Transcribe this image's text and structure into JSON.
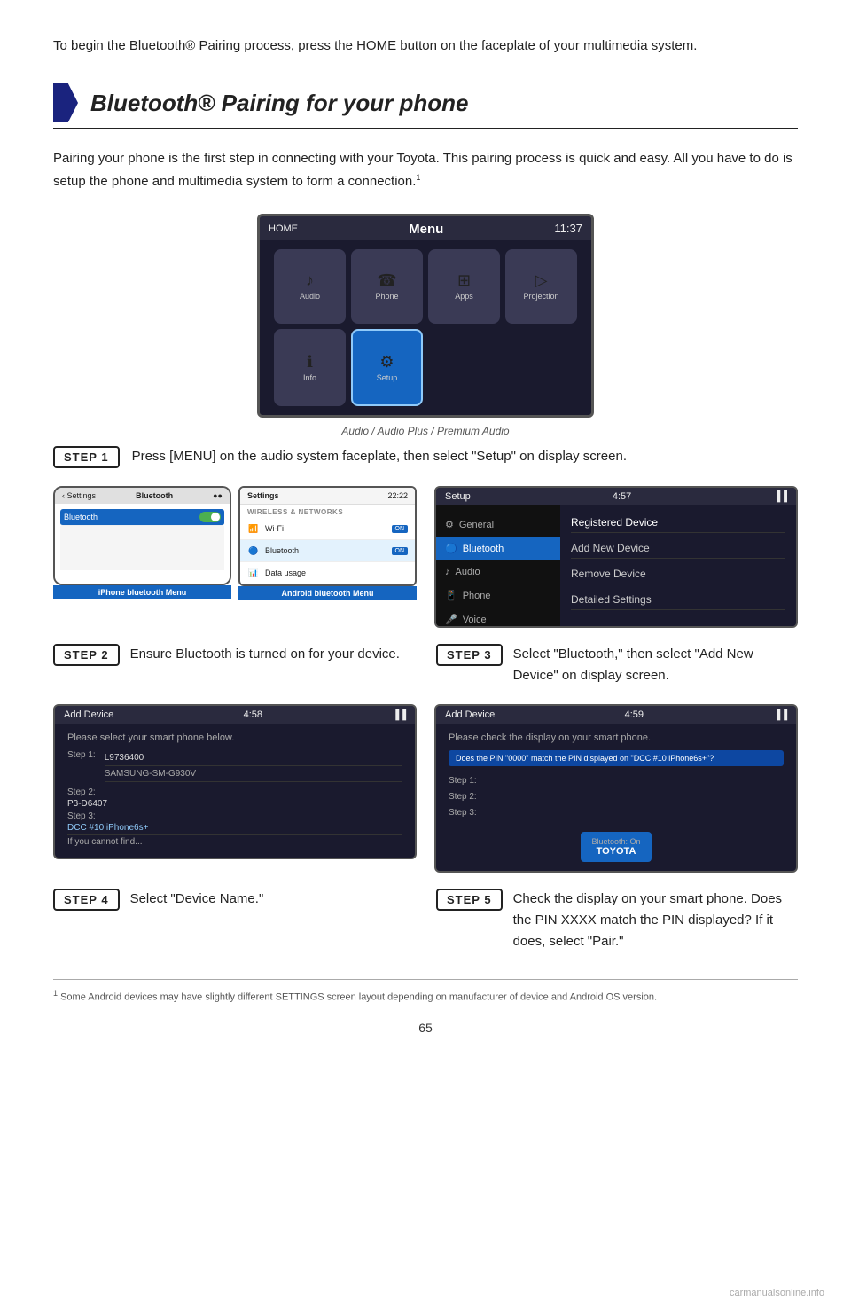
{
  "page": {
    "intro": "To begin the Bluetooth® Pairing process, press the HOME button on the faceplate of your multimedia system.",
    "section_title": "Bluetooth® Pairing for your phone",
    "section_desc": "Pairing your phone is the first step in connecting with your Toyota. This pairing process is quick and easy. All you have to do is setup the phone and multimedia system to form a connection.",
    "footnote_number": "1",
    "screen_caption": "Audio / Audio Plus / Premium Audio",
    "screen": {
      "title": "Menu",
      "time": "11:37",
      "icons": [
        {
          "label": "Audio",
          "sym": "♪"
        },
        {
          "label": "Phone",
          "sym": "📞"
        },
        {
          "label": "Apps",
          "sym": "⊞"
        },
        {
          "label": "Projection",
          "sym": "▶"
        },
        {
          "label": "Info",
          "sym": "ℹ"
        },
        {
          "label": "Setup",
          "sym": "⚙",
          "selected": true
        }
      ]
    },
    "steps": [
      {
        "id": "STEP 1",
        "text": "Press [MENU] on the audio system faceplate, then select \"Setup\" on display screen."
      },
      {
        "id": "STEP 2",
        "text": "Ensure Bluetooth is turned on for your device."
      },
      {
        "id": "STEP 3",
        "text": "Select \"Bluetooth,\" then select \"Add New Device\" on display screen."
      },
      {
        "id": "STEP 4",
        "text": "Select \"Device Name.\""
      },
      {
        "id": "STEP 5",
        "text": "Check the display on your smart phone. Does the PIN XXXX match the PIN displayed? If it does, select \"Pair.\""
      }
    ],
    "iphone_label": "iPhone bluetooth Menu",
    "android_label": "Android bluetooth Menu",
    "iphone_screen": {
      "header_back": "< Settings",
      "header_title": "Bluetooth",
      "rows": [
        {
          "label": "Bluetooth",
          "toggle": "on"
        }
      ]
    },
    "android_screen": {
      "header_title": "Settings",
      "time": "22:22",
      "section": "WIRELESS & NETWORKS",
      "rows": [
        {
          "icon": "📶",
          "label": "Wi-Fi",
          "badge": "ON"
        },
        {
          "icon": "🔵",
          "label": "Bluetooth",
          "badge": "ON"
        },
        {
          "icon": "📊",
          "label": "Data usage"
        }
      ]
    },
    "car_setup_screen": {
      "title": "Setup",
      "time": "4:57",
      "sidebar": [
        {
          "sym": "⚙",
          "label": "General"
        },
        {
          "sym": "🔵",
          "label": "Bluetooth",
          "active": true
        },
        {
          "sym": "♪",
          "label": "Audio"
        },
        {
          "sym": "📱",
          "label": "Phone"
        },
        {
          "sym": "🎤",
          "label": "Voice"
        }
      ],
      "menu_items": [
        "Registered Device",
        "Add New Device",
        "Remove Device",
        "Detailed Settings"
      ]
    },
    "add_device_screen1": {
      "title": "Add Device",
      "time": "4:58",
      "subtitle": "Please select your smart phone below.",
      "steps": [
        "Step 1:",
        "Step 2:",
        "Step 3:"
      ],
      "devices": [
        "L9736400",
        "SAMSUNG-SM-G930V",
        "P3-D6407",
        "DCC #10 iPhone6s+",
        "If you cannot find..."
      ]
    },
    "add_device_screen2": {
      "title": "Add Device",
      "time": "4:59",
      "subtitle": "Please check the display on your smart phone.",
      "pin_question": "Does the PIN \"0000\" match the PIN displayed on \"DCC #10 iPhone6s+\"?",
      "steps": [
        "Step 1:",
        "Step 2:",
        "Step 3:"
      ],
      "bt_title": "Bluetooth: On",
      "bt_brand": "TOYOTA"
    },
    "footnote": "Some Android devices may have slightly different SETTINGS screen layout depending on manufacturer of device and Android OS version.",
    "page_number": "65",
    "watermark": "carmanualsonline.info"
  }
}
